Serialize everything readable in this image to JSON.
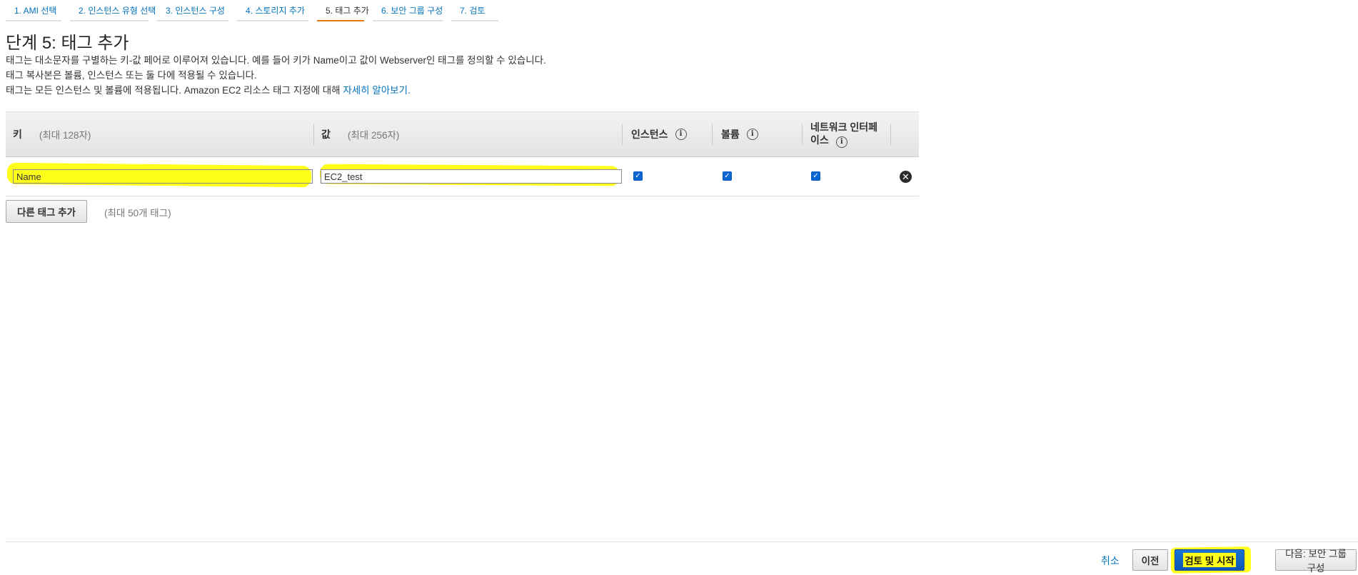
{
  "steps": [
    {
      "label": "1. AMI 선택"
    },
    {
      "label": "2. 인스턴스 유형 선택"
    },
    {
      "label": "3. 인스턴스 구성"
    },
    {
      "label": "4. 스토리지 추가"
    },
    {
      "label": "5. 태그 추가",
      "active": true
    },
    {
      "label": "6. 보안 그룹 구성"
    },
    {
      "label": "7. 검토"
    }
  ],
  "page": {
    "title": "단계 5: 태그 추가",
    "desc1": "태그는 대소문자를 구별하는 키-값 페어로 이루어져 있습니다. 예를 들어 키가 Name이고 값이 Webserver인 태그를 정의할 수 있습니다.",
    "desc2": "태그 복사본은 볼륨, 인스턴스 또는 둘 다에 적용될 수 있습니다.",
    "desc3_prefix": "태그는 모든 인스턴스 및 볼륨에 적용됩니다. Amazon EC2 리소스 태그 지정에 대해",
    "desc3_link": "자세히 알아보기.",
    "desc3_link_separator": " "
  },
  "table": {
    "headers": {
      "key": "키",
      "key_hint": "(최대 128자)",
      "value": "값",
      "value_hint": "(최대 256자)",
      "instances": "인스턴스",
      "volumes": "볼륨",
      "network_line1": "네트워크 인터페",
      "network_line2": "이스"
    },
    "rows": [
      {
        "key": "Name",
        "value": "EC2_test",
        "instances": true,
        "volumes": true,
        "network": true
      }
    ]
  },
  "add_tag": {
    "label": "다른 태그 추가",
    "note": "(최대 50개 태그)"
  },
  "footer": {
    "cancel": "취소",
    "previous": "이전",
    "review_launch": "검토 및 시작",
    "next": "다음: 보안 그룹 구성"
  },
  "icons": {
    "info": "info-icon",
    "remove": "close-icon",
    "check": "checkbox-checked-icon"
  },
  "colors": {
    "link": "#0073bb",
    "active_tab": "#e47911",
    "primary": "#0a57b5",
    "highlight": "#ffff1a"
  }
}
